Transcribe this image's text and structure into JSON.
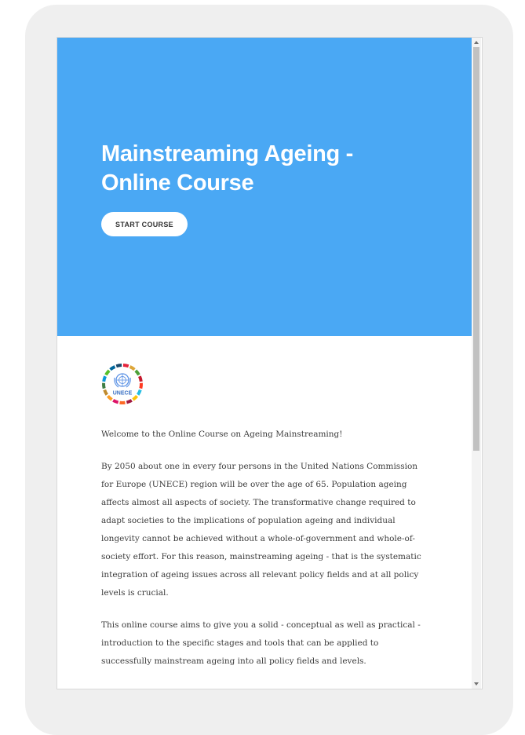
{
  "hero": {
    "title": "Mainstreaming Ageing - Online Course",
    "start_button_label": "START COURSE",
    "background_color": "#4aa8f4"
  },
  "logo": {
    "text": "UNECE",
    "icon": "un-emblem-icon"
  },
  "body": {
    "paragraphs": [
      "Welcome to the Online Course on Ageing Mainstreaming!",
      "By 2050 about one in every four persons in the United Nations Commission for Europe (UNECE) region will be over the age of 65. Population ageing affects almost all aspects of society. The transformative change required to adapt societies to the implications of population ageing and individual longevity cannot be achieved without a whole-of-government and whole-of-society effort. For this reason, mainstreaming ageing - that is the systematic integration of ageing issues across all relevant policy fields and at all policy levels is crucial.",
      "This online course aims to give you a solid - conceptual as well as practical - introduction to the specific stages and tools that can be applied to successfully mainstream ageing into all policy fields and levels."
    ]
  }
}
